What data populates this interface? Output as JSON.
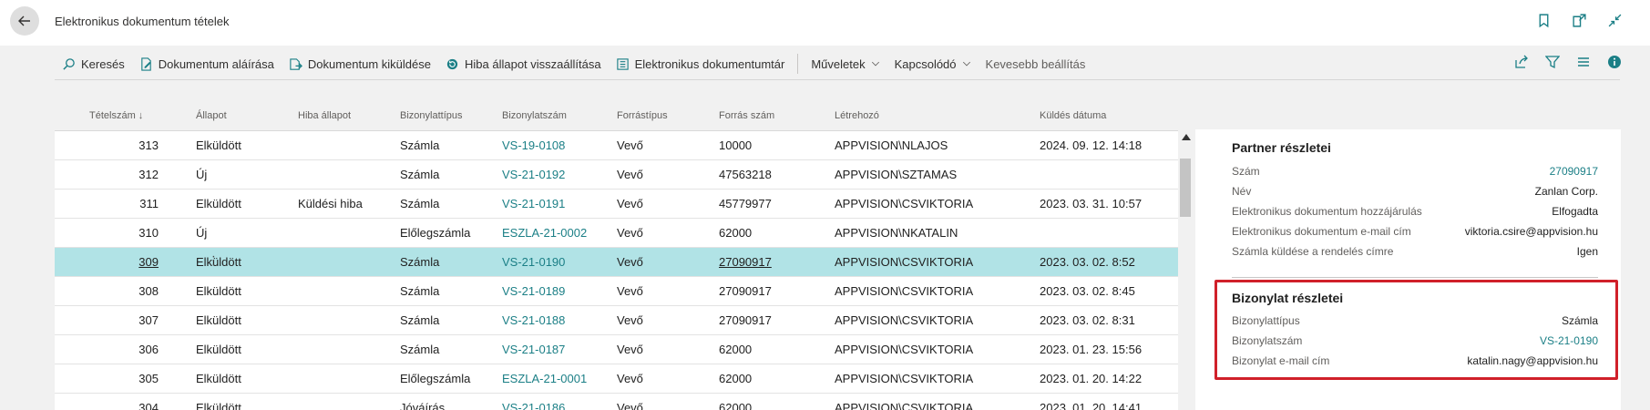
{
  "header": {
    "title": "Elektronikus dokumentum tételek"
  },
  "actions": [
    {
      "label": "Keresés",
      "icon": "search-icon"
    },
    {
      "label": "Dokumentum aláírása",
      "icon": "sign-document-icon"
    },
    {
      "label": "Dokumentum kiküldése",
      "icon": "send-document-icon"
    },
    {
      "label": "Hiba állapot visszaállítása",
      "icon": "reset-status-icon"
    },
    {
      "label": "Elektronikus dokumentumtár",
      "icon": "document-library-icon"
    },
    {
      "label": "Műveletek",
      "icon": "chevron-down-icon"
    },
    {
      "label": "Kapcsolódó",
      "icon": "chevron-down-icon"
    },
    {
      "label": "Kevesebb beállítás"
    }
  ],
  "columns": [
    "Tételszám ↓",
    "Állapot",
    "Hiba állapot",
    "Bizonylattípus",
    "Bizonylatszám",
    "Forrástípus",
    "Forrás szám",
    "Létrehozó",
    "Küldés dátuma"
  ],
  "rows": [
    {
      "no": "313",
      "status": "Elküldött",
      "error": "",
      "doctype": "Számla",
      "docno": "VS-19-0108",
      "srctype": "Vevő",
      "srcno": "10000",
      "creator": "APPVISION\\NLAJOS",
      "date": "2024. 09. 12. 14:18"
    },
    {
      "no": "312",
      "status": "Új",
      "error": "",
      "doctype": "Számla",
      "docno": "VS-21-0192",
      "srctype": "Vevő",
      "srcno": "47563218",
      "creator": "APPVISION\\SZTAMAS",
      "date": ""
    },
    {
      "no": "311",
      "status": "Elküldött",
      "error": "Küldési hiba",
      "doctype": "Számla",
      "docno": "VS-21-0191",
      "srctype": "Vevő",
      "srcno": "45779977",
      "creator": "APPVISION\\CSVIKTORIA",
      "date": "2023. 03. 31. 10:57"
    },
    {
      "no": "310",
      "status": "Új",
      "error": "",
      "doctype": "Előlegszámla",
      "docno": "ESZLA-21-0002",
      "srctype": "Vevő",
      "srcno": "62000",
      "creator": "APPVISION\\NKATALIN",
      "date": ""
    },
    {
      "no": "309",
      "status": "Elküldött",
      "error": "",
      "doctype": "Számla",
      "docno": "VS-21-0190",
      "srctype": "Vevő",
      "srcno": "27090917",
      "creator": "APPVISION\\CSVIKTORIA",
      "date": "2023. 03. 02. 8:52"
    },
    {
      "no": "308",
      "status": "Elküldött",
      "error": "",
      "doctype": "Számla",
      "docno": "VS-21-0189",
      "srctype": "Vevő",
      "srcno": "27090917",
      "creator": "APPVISION\\CSVIKTORIA",
      "date": "2023. 03. 02. 8:45"
    },
    {
      "no": "307",
      "status": "Elküldött",
      "error": "",
      "doctype": "Számla",
      "docno": "VS-21-0188",
      "srctype": "Vevő",
      "srcno": "27090917",
      "creator": "APPVISION\\CSVIKTORIA",
      "date": "2023. 03. 02. 8:31"
    },
    {
      "no": "306",
      "status": "Elküldött",
      "error": "",
      "doctype": "Számla",
      "docno": "VS-21-0187",
      "srctype": "Vevő",
      "srcno": "62000",
      "creator": "APPVISION\\CSVIKTORIA",
      "date": "2023. 01. 23. 15:56"
    },
    {
      "no": "305",
      "status": "Elküldött",
      "error": "",
      "doctype": "Előlegszámla",
      "docno": "ESZLA-21-0001",
      "srctype": "Vevő",
      "srcno": "62000",
      "creator": "APPVISION\\CSVIKTORIA",
      "date": "2023. 01. 20. 14:22"
    },
    {
      "no": "304",
      "status": "Elküldött",
      "error": "",
      "doctype": "Jóváírás",
      "docno": "VS-21-0186",
      "srctype": "Vevő",
      "srcno": "62000",
      "creator": "APPVISION\\CSVIKTORIA",
      "date": "2023. 01. 20. 14:41"
    }
  ],
  "selected_row": "309",
  "partner": {
    "title": "Partner részletei",
    "fields": [
      {
        "label": "Szám",
        "value": "27090917",
        "link": true
      },
      {
        "label": "Név",
        "value": "Zanlan Corp.",
        "link": false
      },
      {
        "label": "Elektronikus dokumentum hozzájárulás",
        "value": "Elfogadta",
        "link": false
      },
      {
        "label": "Elektronikus dokumentum e-mail cím",
        "value": "viktoria.csire@appvision.hu",
        "link": false
      },
      {
        "label": "Számla küldése a rendelés címre",
        "value": "Igen",
        "link": false
      }
    ]
  },
  "document": {
    "title": "Bizonylat részletei",
    "fields": [
      {
        "label": "Bizonylattípus",
        "value": "Számla",
        "link": false
      },
      {
        "label": "Bizonylatszám",
        "value": "VS-21-0190",
        "link": true
      },
      {
        "label": "Bizonylat e-mail cím",
        "value": "katalin.nagy@appvision.hu",
        "link": false
      }
    ]
  },
  "colors": {
    "accent": "#1b7f86",
    "selection": "#b1e3e6",
    "highlight": "#d0202a"
  }
}
